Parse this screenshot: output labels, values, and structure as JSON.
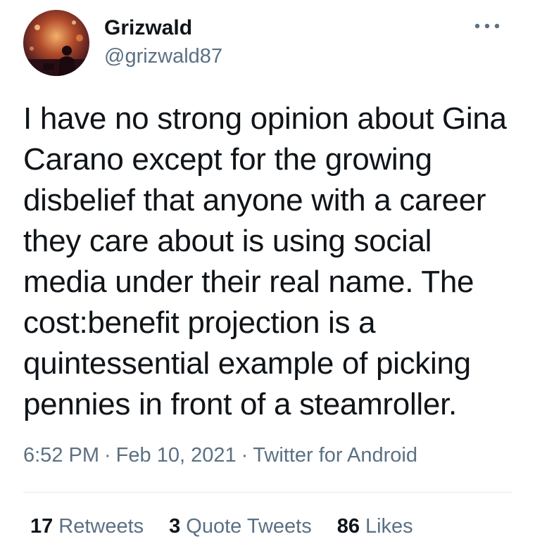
{
  "author": {
    "display_name": "Grizwald",
    "handle": "@grizwald87",
    "avatar_icon": "user-avatar-photo"
  },
  "more_icon": "more-horizontal-icon",
  "tweet": {
    "text": "I have no strong opinion about Gina\nCarano except for the growing\ndisbelief that anyone with a career\nthey care about is using social\nmedia under their real name. The\ncost:benefit projection is a\nquintessential example of picking\npennies in front of a steamroller."
  },
  "meta": {
    "time": "6:52 PM",
    "date": "Feb 10, 2021",
    "source": "Twitter for Android",
    "separator": "·"
  },
  "stats": {
    "retweets": {
      "count": "17",
      "label": "Retweets"
    },
    "quote_tweets": {
      "count": "3",
      "label": "Quote Tweets"
    },
    "likes": {
      "count": "86",
      "label": "Likes"
    }
  },
  "colors": {
    "text_primary": "#0f1419",
    "text_secondary": "#5b7083",
    "divider": "#e1e8ed"
  }
}
